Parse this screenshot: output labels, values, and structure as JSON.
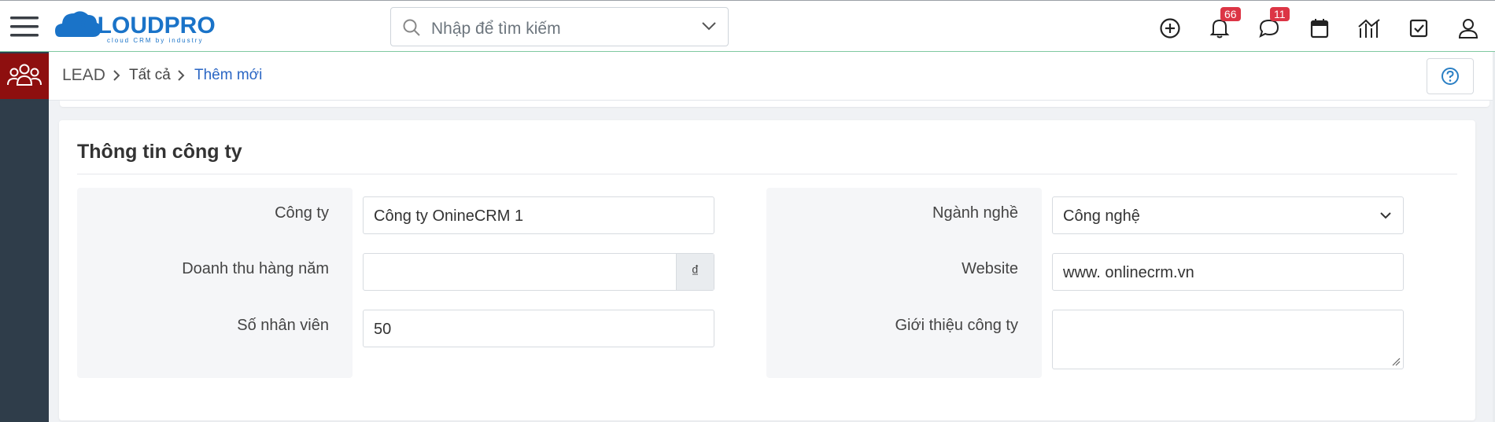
{
  "header": {
    "logo_text": "CLOUDPRO",
    "logo_tagline": "cloud CRM by industry",
    "search_placeholder": "Nhập để tìm kiếm",
    "notifications_count": "66",
    "messages_count": "11",
    "icons": [
      "menu-icon",
      "add-circle-icon",
      "bell-icon",
      "chat-icon",
      "calendar-icon",
      "chart-icon",
      "checkbox-icon",
      "user-icon"
    ]
  },
  "sidebar": {
    "active_icon": "users-icon"
  },
  "breadcrumb": {
    "module": "LEAD",
    "level1": "Tất cả",
    "current": "Thêm mới"
  },
  "section": {
    "title": "Thông tin công ty",
    "fields": {
      "company": {
        "label": "Công ty",
        "value": "Công ty OnineCRM 1"
      },
      "revenue": {
        "label": "Doanh thu hàng năm",
        "value": "",
        "currency": "₫"
      },
      "employees": {
        "label": "Số nhân viên",
        "value": "50"
      },
      "industry": {
        "label": "Ngành nghề",
        "value": "Công nghệ"
      },
      "website": {
        "label": "Website",
        "value": "www. onlinecrm.vn"
      },
      "description": {
        "label": "Giới thiệu công ty",
        "value": ""
      }
    }
  },
  "colors": {
    "brand_blue": "#1a73c8",
    "brand_orange": "#f39c12",
    "sidebar_bg": "#2f3d4a",
    "sidebar_active": "#8e0f0f",
    "badge_red": "#dc3545",
    "link_blue": "#2a66c4"
  }
}
